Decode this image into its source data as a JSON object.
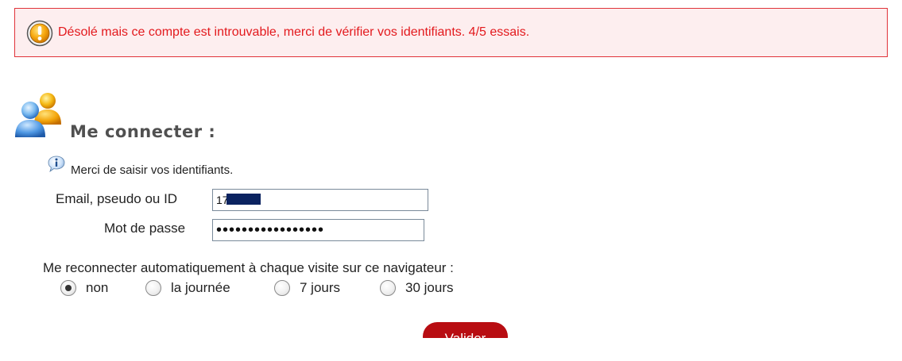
{
  "alert": {
    "icon": "warning-exclamation-icon",
    "message": "Désolé mais ce compte est introuvable, merci de vérifier vos identifiants. 4/5 essais.",
    "border_color": "#e0333a",
    "background_color": "#fdeeef",
    "text_color": "#e3191d"
  },
  "login": {
    "title_icon": "users-icon",
    "title": "Me connecter :",
    "info_icon": "info-icon",
    "info_text": "Merci de saisir vos identifiants.",
    "fields": {
      "email_label": "Email, pseudo ou ID",
      "email_value": "17",
      "password_label": "Mot de passe",
      "password_value": "•••••••••••••••••"
    },
    "reconnect": {
      "question": "Me reconnecter automatiquement à chaque visite sur ce navigateur :",
      "options": [
        {
          "label": "non",
          "checked": true
        },
        {
          "label": "la journée",
          "checked": false
        },
        {
          "label": "7 jours",
          "checked": false
        },
        {
          "label": "30 jours",
          "checked": false
        }
      ]
    },
    "submit_label": "Valider",
    "submit_color": "#b80d12"
  }
}
